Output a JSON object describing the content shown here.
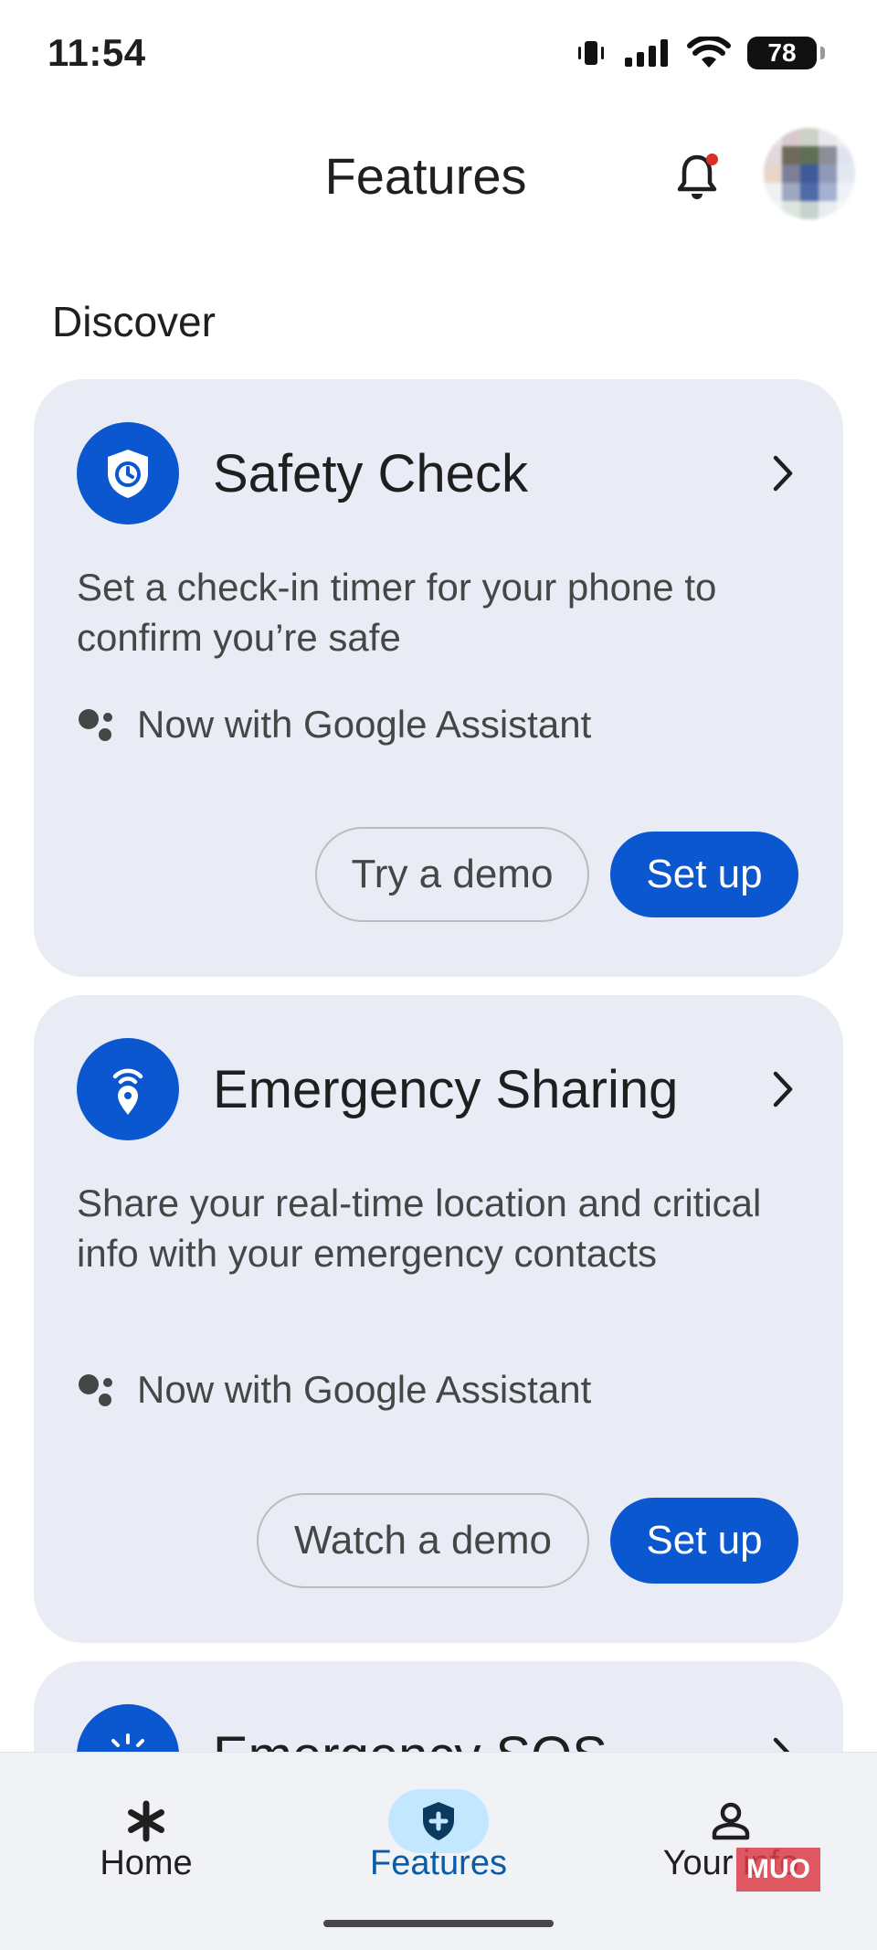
{
  "status_bar": {
    "time": "11:54",
    "battery": "78"
  },
  "header": {
    "title": "Features"
  },
  "section": {
    "title": "Discover"
  },
  "cards": [
    {
      "title": "Safety Check",
      "description": "Set a check-in timer for your phone to confirm you’re safe",
      "assistant_note": "Now with Google Assistant",
      "secondary_button": "Try a demo",
      "primary_button": "Set up"
    },
    {
      "title": "Emergency Sharing",
      "description": "Share your real-time location and critical info with your emergency contacts",
      "assistant_note": "Now with Google Assistant",
      "secondary_button": "Watch a demo",
      "primary_button": "Set up"
    },
    {
      "title": "Emergency SOS"
    }
  ],
  "bottom_nav": {
    "items": [
      {
        "label": "Home",
        "icon": "asterisk-icon"
      },
      {
        "label": "Features",
        "icon": "shield-plus-icon",
        "selected": true
      },
      {
        "label": "Your info",
        "icon": "person-icon"
      }
    ]
  },
  "watermark": "MUO",
  "colors": {
    "accent": "#0b57d0",
    "card_bg": "#e9ecf4",
    "nav_selected_bg": "#c2e7ff",
    "notification_dot": "#d93025"
  }
}
